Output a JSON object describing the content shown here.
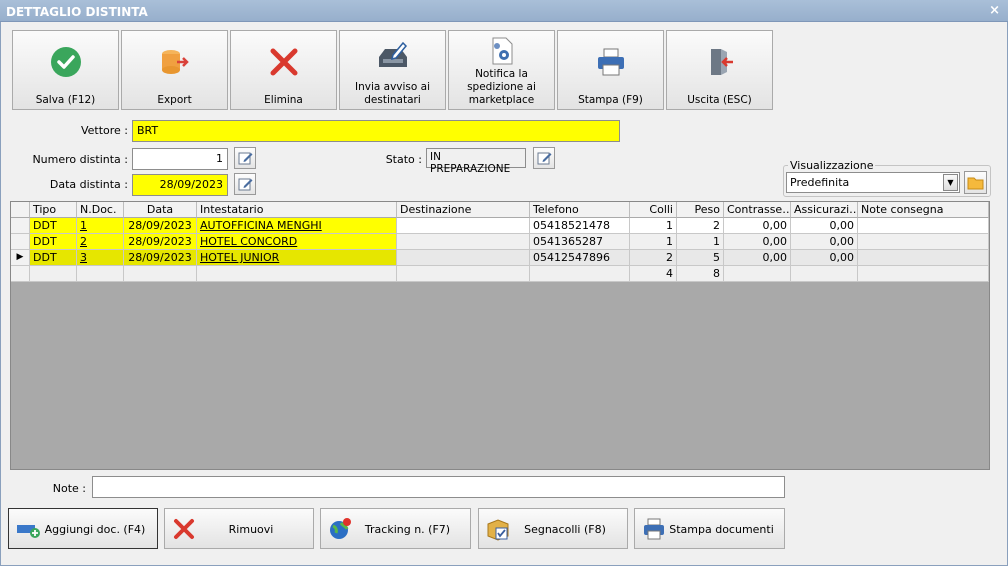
{
  "window": {
    "title": "DETTAGLIO DISTINTA",
    "close": "×"
  },
  "toolbar": [
    {
      "label": "Salva (F12)",
      "icon": "check-icon"
    },
    {
      "label": "Export",
      "icon": "export-icon"
    },
    {
      "label": "Elimina",
      "icon": "delete-icon"
    },
    {
      "label": "Invia avviso ai destinatari",
      "icon": "send-notice-icon"
    },
    {
      "label": "Notifica la spedizione ai marketplace",
      "icon": "document-gear-icon"
    },
    {
      "label": "Stampa (F9)",
      "icon": "printer-icon"
    },
    {
      "label": "Uscita (ESC)",
      "icon": "exit-icon"
    }
  ],
  "form": {
    "vettore_label": "Vettore :",
    "vettore_value": "BRT",
    "numero_label": "Numero distinta :",
    "numero_value": "1",
    "data_label": "Data distinta :",
    "data_value": "28/09/2023",
    "stato_label": "Stato :",
    "stato_value": "IN PREPARAZIONE",
    "visualizzazione_label": "Visualizzazione",
    "visualizzazione_value": "Predefinita"
  },
  "table": {
    "columns": [
      "Tipo",
      "N.Doc.",
      "Data",
      "Intestatario",
      "Destinazione",
      "Telefono",
      "Colli",
      "Peso",
      "Contrasse…",
      "Assicurazi…",
      "Note consegna"
    ],
    "rows": [
      {
        "tipo": "DDT",
        "ndoc": "1",
        "data": "28/09/2023",
        "intestatario": "AUTOFFICINA MENGHI",
        "destinazione": "",
        "telefono": "05418521478",
        "colli": "1",
        "peso": "2",
        "contrassegno": "0,00",
        "assicurazione": "0,00",
        "note": ""
      },
      {
        "tipo": "DDT",
        "ndoc": "2",
        "data": "28/09/2023",
        "intestatario": "HOTEL CONCORD",
        "destinazione": "",
        "telefono": "0541365287",
        "colli": "1",
        "peso": "1",
        "contrassegno": "0,00",
        "assicurazione": "0,00",
        "note": ""
      },
      {
        "tipo": "DDT",
        "ndoc": "3",
        "data": "28/09/2023",
        "intestatario": "HOTEL JUNIOR",
        "destinazione": "",
        "telefono": "05412547896",
        "colli": "2",
        "peso": "5",
        "contrassegno": "0,00",
        "assicurazione": "0,00",
        "note": ""
      }
    ],
    "totals": {
      "colli": "4",
      "peso": "8"
    },
    "current_row_marker": "▶"
  },
  "note": {
    "label": "Note :",
    "value": ""
  },
  "bottom_buttons": [
    {
      "label": "Aggiungi doc. (F4)",
      "icon": "add-document-icon"
    },
    {
      "label": "Rimuovi",
      "icon": "remove-icon"
    },
    {
      "label": "Tracking n. (F7)",
      "icon": "globe-tracking-icon"
    },
    {
      "label": "Segnacolli (F8)",
      "icon": "package-label-icon"
    },
    {
      "label": "Stampa documenti",
      "icon": "printer-icon"
    }
  ],
  "colors": {
    "highlight": "#ffff00",
    "row_selected": "#e6e600",
    "grid_bg": "#a9a9a9"
  }
}
